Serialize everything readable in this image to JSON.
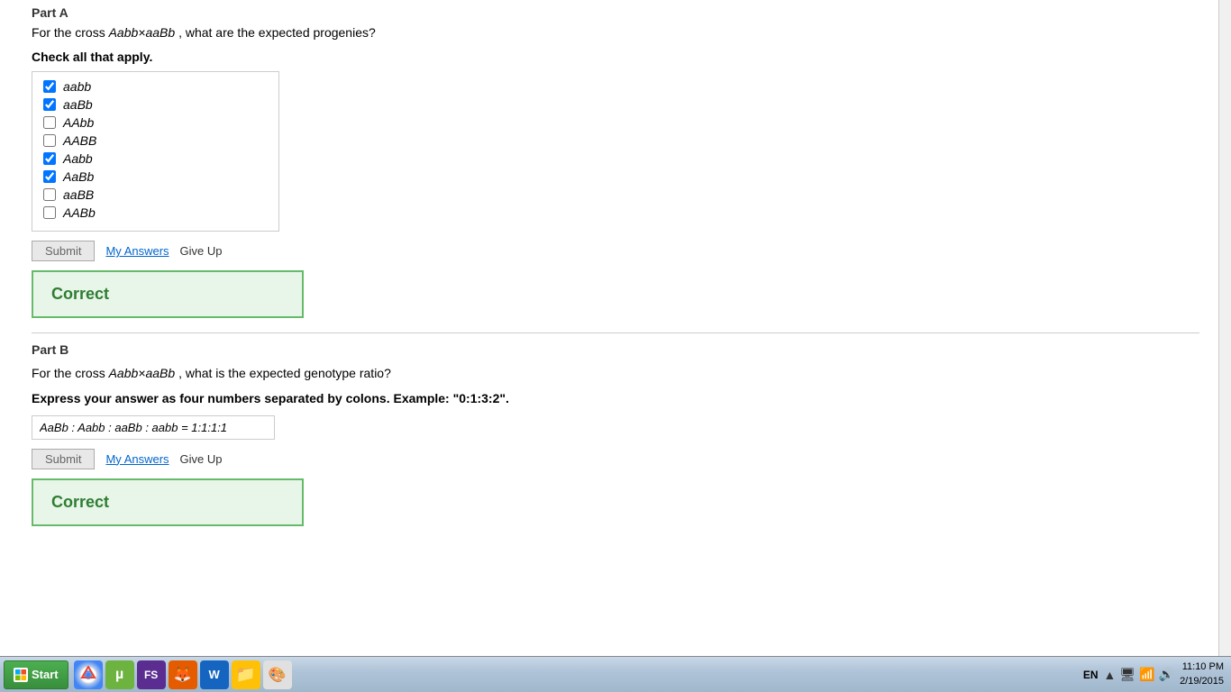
{
  "partA": {
    "header": "Part A",
    "questionPrefix": "For the cross ",
    "crossFormula": "Aabb×aaBb",
    "questionSuffix": ", what are the expected progenies?",
    "checkAll": "Check all that apply.",
    "options": [
      {
        "id": "aabb",
        "label": "aabb",
        "checked": true
      },
      {
        "id": "aaBb",
        "label": "aaBb",
        "checked": true
      },
      {
        "id": "AAbb",
        "label": "AAbb",
        "checked": false
      },
      {
        "id": "AABB",
        "label": "AABB",
        "checked": false
      },
      {
        "id": "Aabb",
        "label": "Aabb",
        "checked": true
      },
      {
        "id": "AaBb",
        "label": "AaBb",
        "checked": true
      },
      {
        "id": "aaBB",
        "label": "aaBB",
        "checked": false
      },
      {
        "id": "AABb",
        "label": "AABb",
        "checked": false
      }
    ],
    "submitLabel": "Submit",
    "myAnswersLabel": "My Answers",
    "giveUpLabel": "Give Up",
    "correctLabel": "Correct"
  },
  "partB": {
    "header": "Part B",
    "questionPrefix": "For the cross ",
    "crossFormula": "Aabb×aaBb",
    "questionSuffix": ", what is the expected genotype ratio?",
    "instruction": "Express your answer as four numbers separated by colons. Example: \"0:1:3:2\".",
    "answerValue": "AaBb : Aabb : aaBb : aabb = 1:1:1:1",
    "answerPlaceholder": "",
    "submitLabel": "Submit",
    "myAnswersLabel": "My Answers",
    "giveUpLabel": "Give Up",
    "correctLabel": "Correct"
  },
  "taskbar": {
    "startLabel": "Start",
    "lang": "EN",
    "time": "11:10 PM",
    "date": "2/19/2015",
    "icons": [
      {
        "name": "chrome",
        "symbol": "🌐"
      },
      {
        "name": "utorrent",
        "symbol": "µ"
      },
      {
        "name": "fsharp",
        "symbol": "F#"
      },
      {
        "name": "firefox",
        "symbol": "🦊"
      },
      {
        "name": "word",
        "symbol": "W"
      },
      {
        "name": "folder",
        "symbol": "📁"
      },
      {
        "name": "paint",
        "symbol": "🎨"
      }
    ]
  }
}
